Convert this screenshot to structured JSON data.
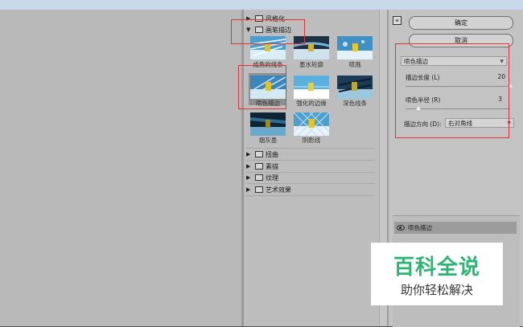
{
  "filters": {
    "folders_top": [
      {
        "label": "风格化",
        "expanded": false
      },
      {
        "label": "画笔描边",
        "expanded": true
      }
    ],
    "brush_strokes": [
      {
        "label": "成角的线条"
      },
      {
        "label": "墨水轮廓"
      },
      {
        "label": "喷溅"
      },
      {
        "label": "喷色描边",
        "selected": true
      },
      {
        "label": "强化的边缘"
      },
      {
        "label": "深色线条"
      },
      {
        "label": "烟灰墨"
      },
      {
        "label": "阴影线"
      }
    ],
    "folders_bottom": [
      {
        "label": "扭曲"
      },
      {
        "label": "素描"
      },
      {
        "label": "纹理"
      },
      {
        "label": "艺术效果"
      }
    ]
  },
  "buttons": {
    "ok": "确定",
    "cancel": "取消"
  },
  "settings": {
    "filter_select": "喷色描边",
    "params": [
      {
        "label": "描边长度 (L)",
        "value": "20",
        "fraction": 1.0
      },
      {
        "label": "喷色半径 (R)",
        "value": "3",
        "fraction": 0.12
      }
    ],
    "direction_label": "描边方向 (D):",
    "direction_value": "右对角线"
  },
  "effect_layers": [
    {
      "label": "喷色描边"
    }
  ],
  "watermark": {
    "title": "百科全说",
    "subtitle": "助你轻松解决"
  },
  "colors": {
    "highlight_border": "#e03434",
    "watermark_green": "#2bb673"
  }
}
